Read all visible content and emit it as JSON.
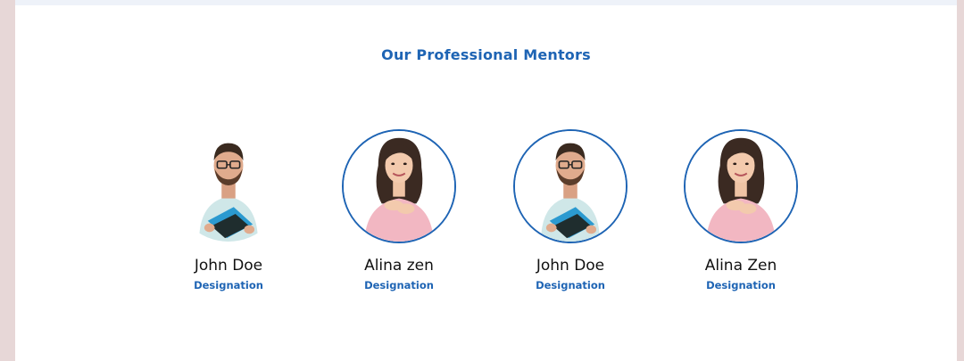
{
  "section": {
    "title": "Our Professional Mentors"
  },
  "mentors": [
    {
      "name": "John Doe",
      "designation": "Designation",
      "ring": false,
      "avatar": "male-mentor-photo"
    },
    {
      "name": "Alina zen",
      "designation": "Designation",
      "ring": true,
      "avatar": "female-mentor-photo"
    },
    {
      "name": "John Doe",
      "designation": "Designation",
      "ring": true,
      "avatar": "male-mentor-photo"
    },
    {
      "name": "Alina Zen",
      "designation": "Designation",
      "ring": true,
      "avatar": "female-mentor-photo"
    }
  ],
  "colors": {
    "accent": "#1e64b4",
    "background": "#ffffff",
    "outer": "#e7d7d7"
  }
}
